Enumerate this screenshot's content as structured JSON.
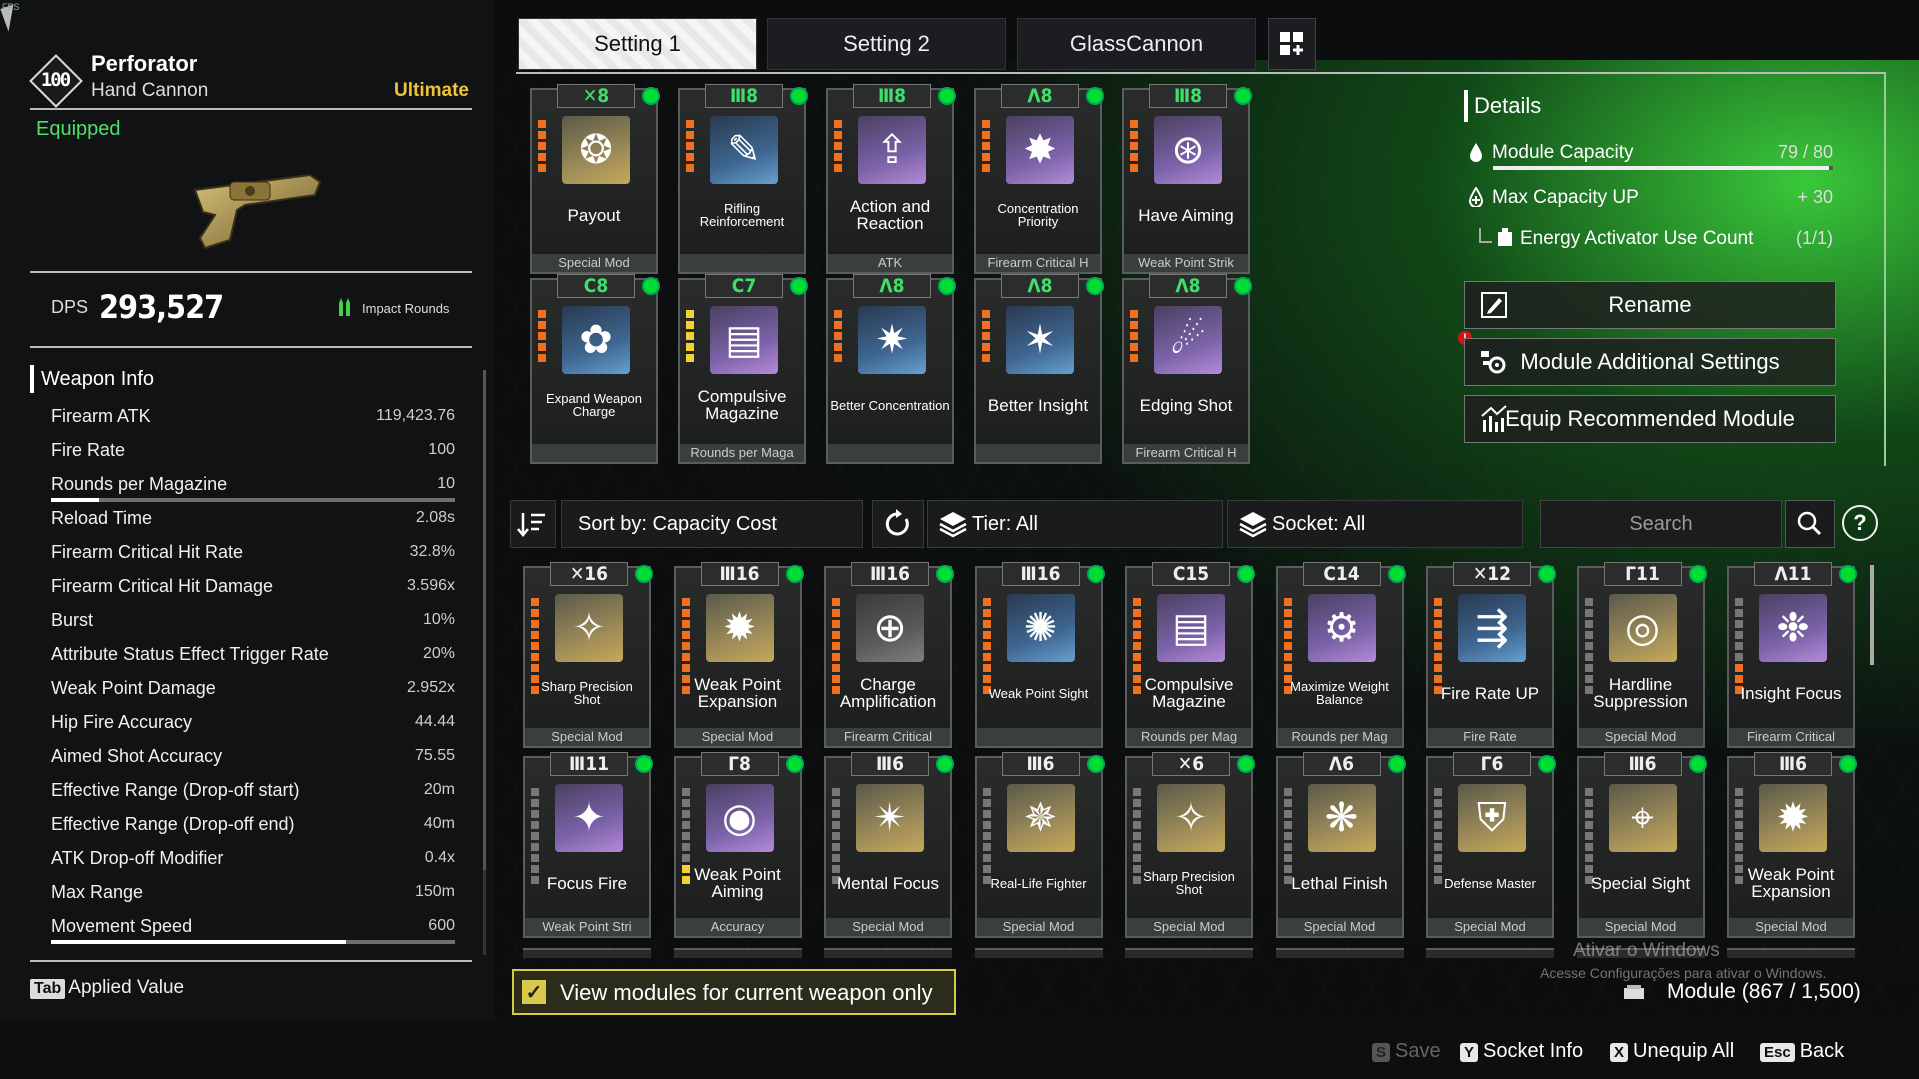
{
  "hud": {
    "fps": "FPS"
  },
  "weapon": {
    "level": "100",
    "name": "Perforator",
    "type": "Hand Cannon",
    "rarity": "Ultimate",
    "status": "Equipped",
    "dps_label": "DPS",
    "dps_value": "293,527",
    "ammo": "Impact Rounds"
  },
  "weapon_info": {
    "title": "Weapon Info",
    "stats": [
      {
        "label": "Firearm ATK",
        "value": "119,423.76"
      },
      {
        "label": "Fire Rate",
        "value": "100"
      },
      {
        "label": "Rounds per Magazine",
        "value": "10",
        "bar": 0.12
      },
      {
        "label": "Reload Time",
        "value": "2.08s"
      },
      {
        "label": "Firearm Critical Hit Rate",
        "value": "32.8%"
      },
      {
        "label": "Firearm Critical Hit Damage",
        "value": "3.596x"
      },
      {
        "label": "Burst",
        "value": "10%"
      },
      {
        "label": "Attribute Status Effect Trigger Rate",
        "value": "20%"
      },
      {
        "label": "Weak Point Damage",
        "value": "2.952x"
      },
      {
        "label": "Hip Fire Accuracy",
        "value": "44.44"
      },
      {
        "label": "Aimed Shot Accuracy",
        "value": "75.55"
      },
      {
        "label": "Effective Range (Drop-off start)",
        "value": "20m"
      },
      {
        "label": "Effective Range (Drop-off end)",
        "value": "40m"
      },
      {
        "label": "ATK Drop-off Modifier",
        "value": "0.4x"
      },
      {
        "label": "Max Range",
        "value": "150m"
      },
      {
        "label": "Movement Speed",
        "value": "600",
        "bar": 0.73
      }
    ],
    "tab_hint_key": "Tab",
    "tab_hint_label": "Applied Value"
  },
  "tabs": [
    {
      "label": "Setting 1",
      "active": true
    },
    {
      "label": "Setting 2",
      "active": false
    },
    {
      "label": "GlassCannon",
      "active": false
    }
  ],
  "equipped_modules": [
    {
      "cost": "8",
      "sym": "✕",
      "name": "Payout",
      "type": "Special Mod",
      "icon": "gold",
      "glyph": "❂",
      "pips": "ooooo",
      "green": true
    },
    {
      "cost": "8",
      "sym": "Ⅲ",
      "name": "Rifling Reinforcement",
      "type": "",
      "icon": "blue",
      "glyph": "✎",
      "pips": "ooooo",
      "green": true,
      "small": true
    },
    {
      "cost": "8",
      "sym": "Ⅲ",
      "name": "Action and Reaction",
      "type": "ATK",
      "icon": "purple",
      "glyph": "⇪",
      "pips": "ooooo",
      "green": true
    },
    {
      "cost": "8",
      "sym": "Λ",
      "name": "Concentration Priority",
      "type": "Firearm Critical H",
      "icon": "purple",
      "glyph": "✸",
      "pips": "ooooo",
      "green": true,
      "small": true
    },
    {
      "cost": "8",
      "sym": "Ⅲ",
      "name": "Have Aiming",
      "type": "Weak Point Strik",
      "icon": "purple",
      "glyph": "⊛",
      "pips": "ooooo",
      "green": true
    },
    {
      "cost": "8",
      "sym": "C",
      "name": "Expand Weapon Charge",
      "type": "",
      "icon": "blue",
      "glyph": "✿",
      "pips": "ooooo",
      "green": true,
      "small": true
    },
    {
      "cost": "7",
      "sym": "C",
      "name": "Compulsive Magazine",
      "type": "Rounds per Maga",
      "icon": "purple",
      "glyph": "▤",
      "pips": "yyyyy",
      "green": true
    },
    {
      "cost": "8",
      "sym": "Λ",
      "name": "Better Concentration",
      "type": "",
      "icon": "blue",
      "glyph": "✷",
      "pips": "ooooo",
      "green": true,
      "small": true
    },
    {
      "cost": "8",
      "sym": "Λ",
      "name": "Better Insight",
      "type": "",
      "icon": "blue",
      "glyph": "✶",
      "pips": "ooooo",
      "green": true
    },
    {
      "cost": "8",
      "sym": "Λ",
      "name": "Edging Shot",
      "type": "Firearm Critical H",
      "icon": "purple",
      "glyph": "☄",
      "pips": "ooooo",
      "green": true
    }
  ],
  "details": {
    "title": "Details",
    "capacity_label": "Module Capacity",
    "capacity_value": "79 / 80",
    "capacity_fraction": 0.9875,
    "max_up_label": "Max Capacity UP",
    "max_up_value": "+ 30",
    "activator_label": "Energy Activator Use Count",
    "activator_value": "(1/1)",
    "rename": "Rename",
    "additional": "Module Additional Settings",
    "recommend": "Equip Recommended Module",
    "warn": "!"
  },
  "filters": {
    "sort": "Sort by: Capacity Cost",
    "tier": "Tier: All",
    "socket": "Socket: All",
    "search_placeholder": "Search",
    "help": "?"
  },
  "inventory": [
    {
      "cost": "16",
      "sym": "✕",
      "name": "Sharp Precision Shot",
      "type": "Special Mod",
      "icon": "gold",
      "glyph": "✧",
      "pips": "ooooooooo",
      "small": true
    },
    {
      "cost": "16",
      "sym": "Ⅲ",
      "name": "Weak Point Expansion",
      "type": "Special Mod",
      "icon": "gold",
      "glyph": "✹",
      "pips": "ooooooooo"
    },
    {
      "cost": "16",
      "sym": "Ⅲ",
      "name": "Charge Amplification",
      "type": "Firearm Critical",
      "icon": "gray",
      "glyph": "⊕",
      "pips": "ooooooooo"
    },
    {
      "cost": "16",
      "sym": "Ⅲ",
      "name": "Weak Point Sight",
      "type": "",
      "icon": "blue",
      "glyph": "✺",
      "pips": "ooooooooo",
      "small": true
    },
    {
      "cost": "15",
      "sym": "C",
      "name": "Compulsive Magazine",
      "type": "Rounds per Mag",
      "icon": "purple",
      "glyph": "▤",
      "pips": "ooooooooo"
    },
    {
      "cost": "14",
      "sym": "C",
      "name": "Maximize Weight Balance",
      "type": "Rounds per Mag",
      "icon": "purple",
      "glyph": "⚙",
      "pips": "ooooooooo",
      "small": true
    },
    {
      "cost": "12",
      "sym": "✕",
      "name": "Fire Rate UP",
      "type": "Fire Rate",
      "icon": "blue",
      "glyph": "⇶",
      "pips": "ooooooooo"
    },
    {
      "cost": "11",
      "sym": "Γ",
      "name": "Hardline Suppression",
      "type": "Special Mod",
      "icon": "gold",
      "glyph": "◎",
      "pips": "ggggggggg"
    },
    {
      "cost": "11",
      "sym": "Λ",
      "name": "Insight Focus",
      "type": "Firearm Critical",
      "icon": "purple",
      "glyph": "❉",
      "pips": "ggggggooo"
    },
    {
      "cost": "11",
      "sym": "Ⅲ",
      "name": "Focus Fire",
      "type": "Weak Point Stri",
      "icon": "purple",
      "glyph": "✦",
      "pips": "ggggggggg"
    },
    {
      "cost": "8",
      "sym": "Γ",
      "name": "Weak Point Aiming",
      "type": "Accuracy",
      "icon": "purple",
      "glyph": "◉",
      "pips": "gggggggyy"
    },
    {
      "cost": "6",
      "sym": "Ⅲ",
      "name": "Mental Focus",
      "type": "Special Mod",
      "icon": "gold",
      "glyph": "✴",
      "pips": "ggggggggg"
    },
    {
      "cost": "6",
      "sym": "Ⅲ",
      "name": "Real-Life Fighter",
      "type": "Special Mod",
      "icon": "gold",
      "glyph": "✵",
      "pips": "ggggggggg",
      "small": true
    },
    {
      "cost": "6",
      "sym": "✕",
      "name": "Sharp Precision Shot",
      "type": "Special Mod",
      "icon": "gold",
      "glyph": "✧",
      "pips": "ggggggggg",
      "small": true
    },
    {
      "cost": "6",
      "sym": "Λ",
      "name": "Lethal Finish",
      "type": "Special Mod",
      "icon": "gold",
      "glyph": "❋",
      "pips": "ggggggggg"
    },
    {
      "cost": "6",
      "sym": "Γ",
      "name": "Defense Master",
      "type": "Special Mod",
      "icon": "gold",
      "glyph": "⛨",
      "pips": "ggggggggg",
      "small": true
    },
    {
      "cost": "6",
      "sym": "Ⅲ",
      "name": "Special Sight",
      "type": "Special Mod",
      "icon": "gold",
      "glyph": "⌖",
      "pips": "ggggggggg"
    },
    {
      "cost": "6",
      "sym": "Ⅲ",
      "name": "Weak Point Expansion",
      "type": "Special Mod",
      "icon": "gold",
      "glyph": "✹",
      "pips": "ggggggggg"
    }
  ],
  "view_current_only": "View modules for current weapon only",
  "checkbox_mark": "✓",
  "watermark": {
    "line1": "Ativar o Windows",
    "line2": "Acesse Configurações para ativar o Windows."
  },
  "module_count": "Module (867 / 1,500)",
  "footer": [
    {
      "key": "S",
      "label": "Save",
      "disabled": true
    },
    {
      "key": "Y",
      "label": "Socket Info",
      "disabled": false
    },
    {
      "key": "X",
      "label": "Unequip All",
      "disabled": false
    },
    {
      "key": "Esc",
      "label": "Back",
      "disabled": false
    }
  ],
  "colors": {
    "accent_green": "#3fe06a",
    "rarity_gold": "#f1c232",
    "checkbox_yellow": "#d8c94a"
  }
}
